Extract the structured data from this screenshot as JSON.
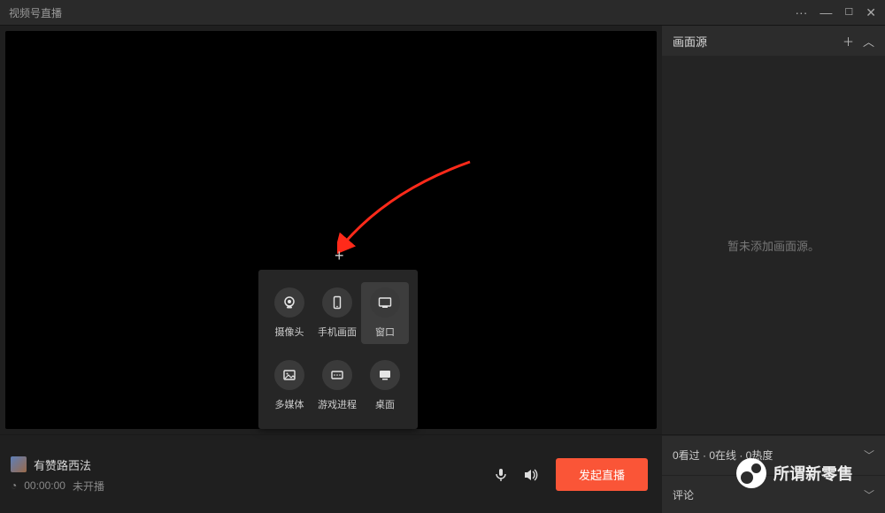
{
  "titlebar": {
    "title": "视频号直播"
  },
  "stage": {
    "plus": "+"
  },
  "popup": {
    "items": [
      {
        "id": "camera",
        "label": "摄像头"
      },
      {
        "id": "phone",
        "label": "手机画面"
      },
      {
        "id": "window",
        "label": "窗口",
        "hl": true
      },
      {
        "id": "media",
        "label": "多媒体"
      },
      {
        "id": "game",
        "label": "游戏进程"
      },
      {
        "id": "desktop",
        "label": "桌面"
      }
    ]
  },
  "sidebar": {
    "title": "画面源",
    "empty": "暂未添加画面源。"
  },
  "bottom": {
    "username": "有赞路西法",
    "time": "00:00:00",
    "status": "未开播",
    "start_label": "发起直播",
    "stats": "0看过 · 0在线 · 0热度",
    "comments_label": "评论"
  },
  "watermark": {
    "text": "所谓新零售"
  }
}
